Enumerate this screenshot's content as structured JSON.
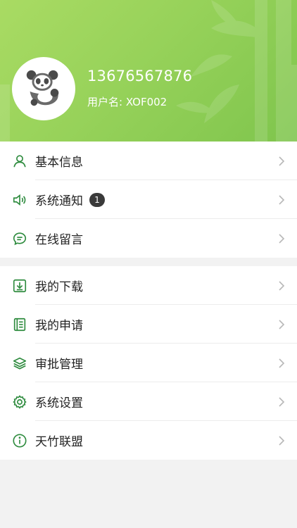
{
  "profile": {
    "phone": "13676567876",
    "username": "用户名: XOF002",
    "avatar_icon": "panda-icon"
  },
  "theme": {
    "accent": "#2e8b3e",
    "header_gradient": [
      "#a9db63",
      "#7fc54d"
    ]
  },
  "menu_group_1": [
    {
      "label": "基本信息",
      "icon": "user-icon"
    },
    {
      "label": "系统通知",
      "icon": "speaker-icon",
      "badge": "1"
    },
    {
      "label": "在线留言",
      "icon": "chat-icon"
    }
  ],
  "menu_group_2": [
    {
      "label": "我的下载",
      "icon": "download-icon"
    },
    {
      "label": "我的申请",
      "icon": "document-icon"
    },
    {
      "label": "审批管理",
      "icon": "layers-icon"
    },
    {
      "label": "系统设置",
      "icon": "gear-icon"
    },
    {
      "label": "天竹联盟",
      "icon": "info-icon"
    }
  ]
}
